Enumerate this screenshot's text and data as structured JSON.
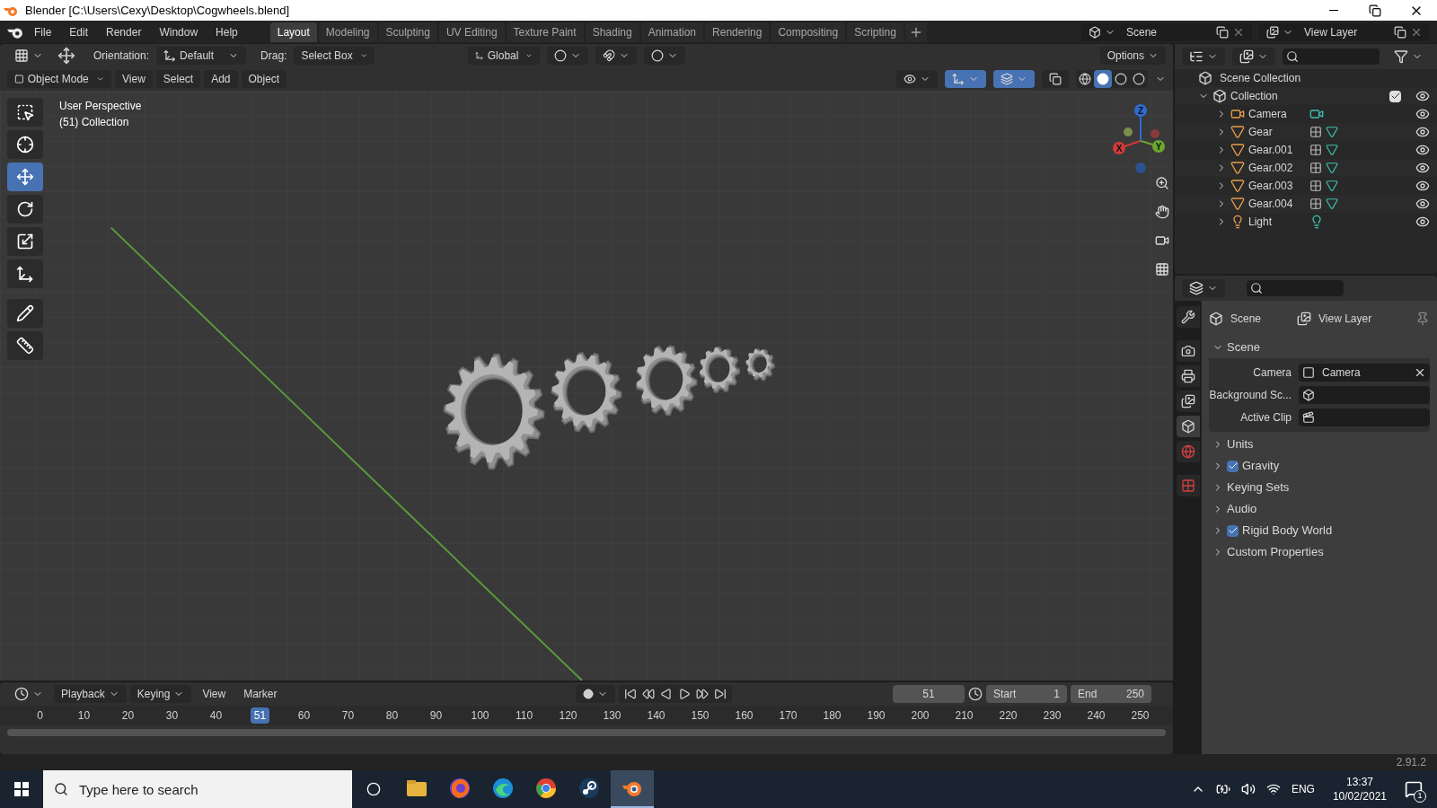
{
  "window": {
    "title": "Blender [C:\\Users\\Cexy\\Desktop\\Cogwheels.blend]"
  },
  "menu": [
    "File",
    "Edit",
    "Render",
    "Window",
    "Help"
  ],
  "workspaces": [
    {
      "label": "Layout",
      "selected": true
    },
    {
      "label": "Modeling",
      "selected": false
    },
    {
      "label": "Sculpting",
      "selected": false
    },
    {
      "label": "UV Editing",
      "selected": false
    },
    {
      "label": "Texture Paint",
      "selected": false
    },
    {
      "label": "Shading",
      "selected": false
    },
    {
      "label": "Animation",
      "selected": false
    },
    {
      "label": "Rendering",
      "selected": false
    },
    {
      "label": "Compositing",
      "selected": false
    },
    {
      "label": "Scripting",
      "selected": false
    }
  ],
  "scene_field": "Scene",
  "view_layer_field": "View Layer",
  "viewport_header": {
    "orientation_label": "Orientation:",
    "orientation": "Default",
    "drag_label": "Drag:",
    "drag": "Select Box",
    "transform": "Global",
    "options": "Options"
  },
  "mode_bar": {
    "mode": "Object Mode",
    "menus": [
      "View",
      "Select",
      "Add",
      "Object"
    ]
  },
  "header_toggles": [
    {
      "kind": "gizmo",
      "on": true
    },
    {
      "kind": "overlay",
      "on": true
    },
    {
      "kind": "xray",
      "on": false
    }
  ],
  "shading_modes": [
    {
      "kind": "wireframe",
      "selected": false
    },
    {
      "kind": "solid",
      "selected": true
    },
    {
      "kind": "material",
      "selected": false
    },
    {
      "kind": "rendered",
      "selected": false
    }
  ],
  "viewport": {
    "overlay_lines": [
      "User Perspective",
      "(51) Collection"
    ],
    "gizmo_axes": [
      "X",
      "Y",
      "Z"
    ]
  },
  "tools": [
    {
      "kind": "select",
      "selected": false
    },
    {
      "kind": "cursor",
      "selected": false
    },
    {
      "kind": "move",
      "selected": true
    },
    {
      "kind": "rotate",
      "selected": false
    },
    {
      "kind": "scale",
      "selected": false
    },
    {
      "kind": "transform",
      "selected": false
    },
    {
      "kind": "annotate",
      "selected": false
    },
    {
      "kind": "measure",
      "selected": false
    }
  ],
  "outliner": {
    "label": "Scene Collection",
    "children": [
      {
        "label": "Collection",
        "kind": "collection",
        "expanded": true,
        "checked": true,
        "children": [
          {
            "label": "Camera",
            "kind": "camera",
            "expanded": false
          },
          {
            "label": "Gear",
            "kind": "mesh",
            "expanded": false
          },
          {
            "label": "Gear.001",
            "kind": "mesh",
            "expanded": false
          },
          {
            "label": "Gear.002",
            "kind": "mesh",
            "expanded": false
          },
          {
            "label": "Gear.003",
            "kind": "mesh",
            "expanded": false
          },
          {
            "label": "Gear.004",
            "kind": "mesh",
            "expanded": false
          },
          {
            "label": "Light",
            "kind": "light",
            "expanded": false
          }
        ]
      }
    ]
  },
  "properties": {
    "tabs": [
      {
        "kind": "tool",
        "selected": false
      },
      {
        "kind": "render",
        "selected": false
      },
      {
        "kind": "output",
        "selected": false
      },
      {
        "kind": "view_layer",
        "selected": false
      },
      {
        "kind": "scene",
        "selected": true
      },
      {
        "kind": "world",
        "selected": false
      },
      {
        "kind": "texture",
        "selected": false
      }
    ],
    "breadcrumb": [
      "Scene",
      "View Layer"
    ],
    "panel": {
      "title": "Scene",
      "expanded": true,
      "fields": [
        {
          "label": "Camera",
          "kind": "camera",
          "value": "Camera"
        },
        {
          "label": "Background Sc...",
          "kind": "scene"
        },
        {
          "label": "Active Clip",
          "kind": "clip"
        }
      ]
    },
    "subpanels": [
      {
        "label": "Units",
        "kind": "plain"
      },
      {
        "label": "Gravity",
        "kind": "checkbox",
        "checked": true
      },
      {
        "label": "Keying Sets",
        "kind": "plain"
      },
      {
        "label": "Audio",
        "kind": "plain"
      },
      {
        "label": "Rigid Body World",
        "kind": "checkbox",
        "checked": true
      },
      {
        "label": "Custom Properties",
        "kind": "plain"
      }
    ]
  },
  "timeline": {
    "menus": [
      "Playback",
      "Keying",
      "View",
      "Marker"
    ],
    "current_frame": "51",
    "start_label": "Start",
    "start": "1",
    "end_label": "End",
    "end": "250",
    "ticks": [
      {
        "label": "0",
        "selected": false
      },
      {
        "label": "10",
        "selected": false
      },
      {
        "label": "20",
        "selected": false
      },
      {
        "label": "30",
        "selected": false
      },
      {
        "label": "40",
        "selected": false
      },
      {
        "label": "51",
        "selected": true
      },
      {
        "label": "60",
        "selected": false
      },
      {
        "label": "70",
        "selected": false
      },
      {
        "label": "80",
        "selected": false
      },
      {
        "label": "90",
        "selected": false
      },
      {
        "label": "100",
        "selected": false
      },
      {
        "label": "110",
        "selected": false
      },
      {
        "label": "120",
        "selected": false
      },
      {
        "label": "130",
        "selected": false
      },
      {
        "label": "140",
        "selected": false
      },
      {
        "label": "150",
        "selected": false
      },
      {
        "label": "160",
        "selected": false
      },
      {
        "label": "170",
        "selected": false
      },
      {
        "label": "180",
        "selected": false
      },
      {
        "label": "190",
        "selected": false
      },
      {
        "label": "200",
        "selected": false
      },
      {
        "label": "210",
        "selected": false
      },
      {
        "label": "220",
        "selected": false
      },
      {
        "label": "230",
        "selected": false
      },
      {
        "label": "240",
        "selected": false
      },
      {
        "label": "250",
        "selected": false
      }
    ]
  },
  "status_bar": {
    "version": "2.91.2"
  },
  "taskbar": {
    "search_placeholder": "Type here to search",
    "apps": [
      {
        "kind": "folder",
        "selected": false
      },
      {
        "kind": "fox",
        "selected": false
      },
      {
        "kind": "wave",
        "selected": false
      },
      {
        "kind": "ring",
        "selected": false
      },
      {
        "kind": "steam",
        "selected": false
      },
      {
        "kind": "blender",
        "selected": true
      }
    ],
    "language": "ENG",
    "time": "13:37",
    "date": "10/02/2021",
    "notifications": "1"
  }
}
